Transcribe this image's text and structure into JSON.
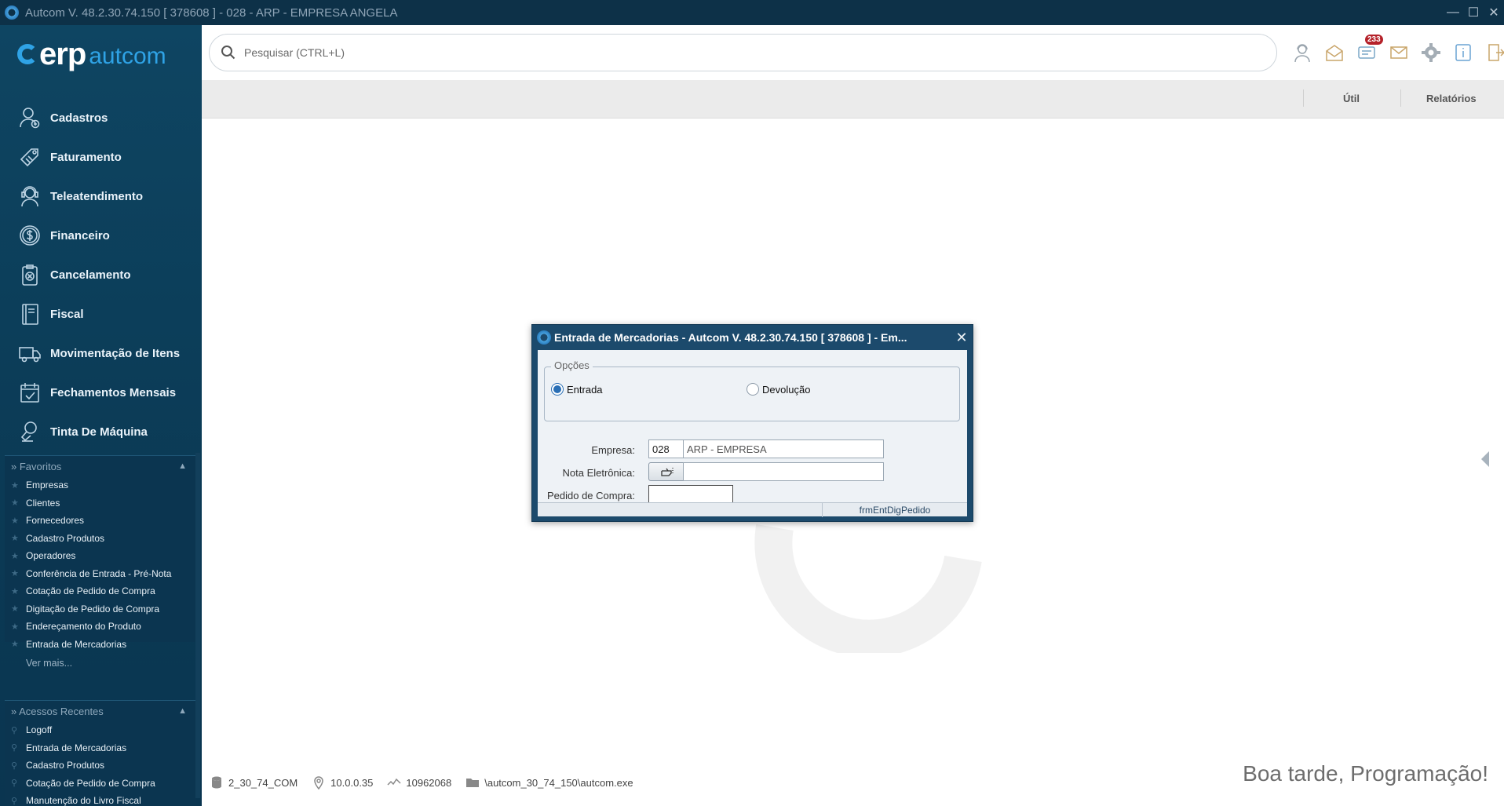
{
  "window": {
    "title": "Autcom V. 48.2.30.74.150 [ 378608 ] - 028 - ARP - EMPRESA ANGELA",
    "minimize": "—",
    "maximize": "☐",
    "close": "✕"
  },
  "logo": {
    "erp": "erp",
    "autcom": "autcom"
  },
  "sidebar": {
    "menu": [
      {
        "label": "Cadastros",
        "icon": "user-add-icon"
      },
      {
        "label": "Faturamento",
        "icon": "tag-icon"
      },
      {
        "label": "Teleatendimento",
        "icon": "headset-icon"
      },
      {
        "label": "Financeiro",
        "icon": "dollar-coin-icon"
      },
      {
        "label": "Cancelamento",
        "icon": "cancel-clipboard-icon"
      },
      {
        "label": "Fiscal",
        "icon": "notebook-icon"
      },
      {
        "label": "Movimentação de Itens",
        "icon": "truck-icon"
      },
      {
        "label": "Fechamentos Mensais",
        "icon": "calendar-check-icon"
      },
      {
        "label": "Tinta De Máquina",
        "icon": "ink-cartridge-icon"
      }
    ],
    "favoritos": {
      "title": "» Favoritos",
      "items": [
        "Empresas",
        "Clientes",
        "Fornecedores",
        "Cadastro Produtos",
        "Operadores",
        "Conferência de Entrada - Pré-Nota",
        "Cotação de Pedido de Compra",
        "Digitação de Pedido de Compra",
        "Endereçamento do Produto",
        "Entrada de Mercadorias"
      ],
      "more": "Ver mais..."
    },
    "recentes": {
      "title": "» Acessos Recentes",
      "items": [
        "Logoff",
        "Entrada de Mercadorias",
        "Cadastro Produtos",
        "Cotação de Pedido de Compra",
        "Manutenção do Livro Fiscal"
      ]
    }
  },
  "search": {
    "placeholder": "Pesquisar (CTRL+L)"
  },
  "top_icons": {
    "items": [
      "support-agent-icon",
      "open-mail-icon",
      "messages-icon",
      "envelope-icon",
      "gear-icon",
      "info-icon",
      "exit-icon"
    ],
    "messages_badge": "233"
  },
  "toolbar": {
    "util": "Útil",
    "relatorios": "Relatórios"
  },
  "status": {
    "database": "2_30_74_COM",
    "ip": "10.0.0.35",
    "session": "10962068",
    "path": "\\autcom_30_74_150\\autcom.exe"
  },
  "greeting": "Boa tarde, Programação!",
  "dialog": {
    "title": "Entrada de Mercadorias  -  Autcom V. 48.2.30.74.150 [ 378608 ] - Em...",
    "close": "✕",
    "opcoes_legend": "Opções",
    "radio_entrada": "Entrada",
    "radio_devolucao": "Devolução",
    "selected": "Entrada",
    "empresa_label": "Empresa:",
    "empresa_code": "028",
    "empresa_name": "ARP - EMPRESA",
    "nota_label": "Nota Eletrônica:",
    "nota_value": "",
    "pedido_label": "Pedido de Compra:",
    "pedido_value": "",
    "status_form": "frmEntDigPedido"
  },
  "colors": {
    "sidebar_bg": "#0e4562",
    "accent": "#2fa3e6",
    "dialog_frame": "#1c4a6c",
    "badge": "#b5222a"
  }
}
